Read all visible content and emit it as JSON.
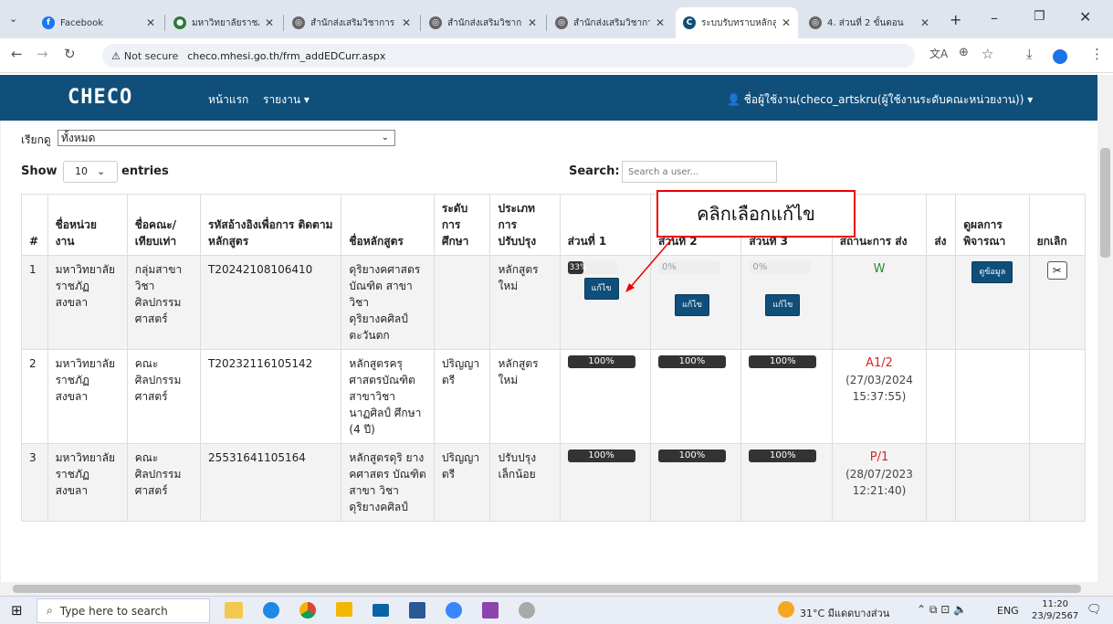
{
  "browser": {
    "tabs": [
      {
        "title": "Facebook",
        "fav_color": "#1877f2",
        "fav_glyph": "f"
      },
      {
        "title": "มหาวิทยาลัยราชภัฏสงขลา",
        "fav_color": "#2a7a3a",
        "fav_glyph": "●"
      },
      {
        "title": "สำนักส่งเสริมวิชาการ",
        "fav_color": "#666",
        "fav_glyph": "◎"
      },
      {
        "title": "สำนักส่งเสริมวิชาการ",
        "fav_color": "#666",
        "fav_glyph": "◎"
      },
      {
        "title": "สำนักส่งเสริมวิชาการ",
        "fav_color": "#666",
        "fav_glyph": "◎"
      },
      {
        "title": "ระบบรับทราบหลักสูตร",
        "fav_color": "#0f4f7a",
        "fav_glyph": "C",
        "active": true
      },
      {
        "title": "4. ส่วนที่ 2 ขั้นตอน",
        "fav_color": "#666",
        "fav_glyph": "◎"
      }
    ],
    "not_secure": "Not secure",
    "url": "checo.mhesi.go.th/frm_addEDCurr.aspx"
  },
  "nav": {
    "logo": "CHECO",
    "home": "หน้าแรก",
    "report": "รายงาน",
    "user": "ชื่อผู้ใช้งาน(checo_artskru(ผู้ใช้งานระดับคณะหน่วยงาน))"
  },
  "filter": {
    "label": "เรียกดู",
    "value": "ทั้งหมด"
  },
  "list": {
    "show": "Show",
    "entries_value": "10",
    "entries": "entries",
    "search_label": "Search:",
    "search_placeholder": "Search a user..."
  },
  "callout": "คลิกเลือกแก้ไข",
  "headers": [
    "#",
    "ชื่อหน่วย งาน",
    "ชื่อคณะ/ เทียบเท่า",
    "รหัสอ้างอิงเพื่อการ ติดตามหลักสูตร",
    "ชื่อหลักสูตร",
    "ระดับ การ ศึกษา",
    "ประเภท การ ปรับปรุง",
    "ส่วนที่ 1",
    "ส่วนที่ 2",
    "ส่วนที่ 3",
    "สถานะการ ส่ง",
    "ส่ง",
    "ดูผลการ พิจารณา",
    "ยกเลิก"
  ],
  "rows": [
    {
      "no": "1",
      "unit": "มหาวิทยาลัย ราชภัฏสงขลา",
      "faculty": "กลุ่มสาขา วิชา ศิลปกรรม ศาสตร์",
      "code": "T20242108106410",
      "name": "ดุริยางคศาสตร บัณฑิต สาขา วิชา ดุริยางคศิลป์ ตะวันตก",
      "level": "",
      "type": "หลักสูตร ใหม่",
      "p1": "33%",
      "p2": "0%",
      "p3": "0%",
      "status": "W",
      "status_date": "",
      "edit": "แก้ไข",
      "view": "ดูข้อมูล"
    },
    {
      "no": "2",
      "unit": "มหาวิทยาลัย ราชภัฏสงขลา",
      "faculty": "คณะ ศิลปกรรม ศาสตร์",
      "code": "T20232116105142",
      "name": "หลักสูตรครุ ศาสตรบัณฑิต สาขาวิชา นาฏศิลป์ ศึกษา (4 ปี)",
      "level": "ปริญญา ตรี",
      "type": "หลักสูตร ใหม่",
      "p1": "100%",
      "p2": "100%",
      "p3": "100%",
      "status": "A1/2",
      "status_date": "(27/03/2024 15:37:55)"
    },
    {
      "no": "3",
      "unit": "มหาวิทยาลัย ราชภัฏสงขลา",
      "faculty": "คณะ ศิลปกรรม ศาสตร์",
      "code": "25531641105164",
      "name": "หลักสูตรดุริ ยางคศาสตร บัณฑิต สาขา วิชา ดุริยางคศิลป์",
      "level": "ปริญญา ตรี",
      "type": "ปรับปรุง เล็กน้อย",
      "p1": "100%",
      "p2": "100%",
      "p3": "100%",
      "status": "P/1",
      "status_date": "(28/07/2023 12:21:40)"
    }
  ],
  "taskbar": {
    "search": "Type here to search",
    "weather": "31°C มีแดดบางส่วน",
    "lang": "ENG",
    "time": "11:20",
    "date": "23/9/2567"
  },
  "colors": {
    "navbar": "#0f4f7a",
    "status_w": "#2e8b2e",
    "status_other": "#d22",
    "callout_border": "#e00"
  }
}
